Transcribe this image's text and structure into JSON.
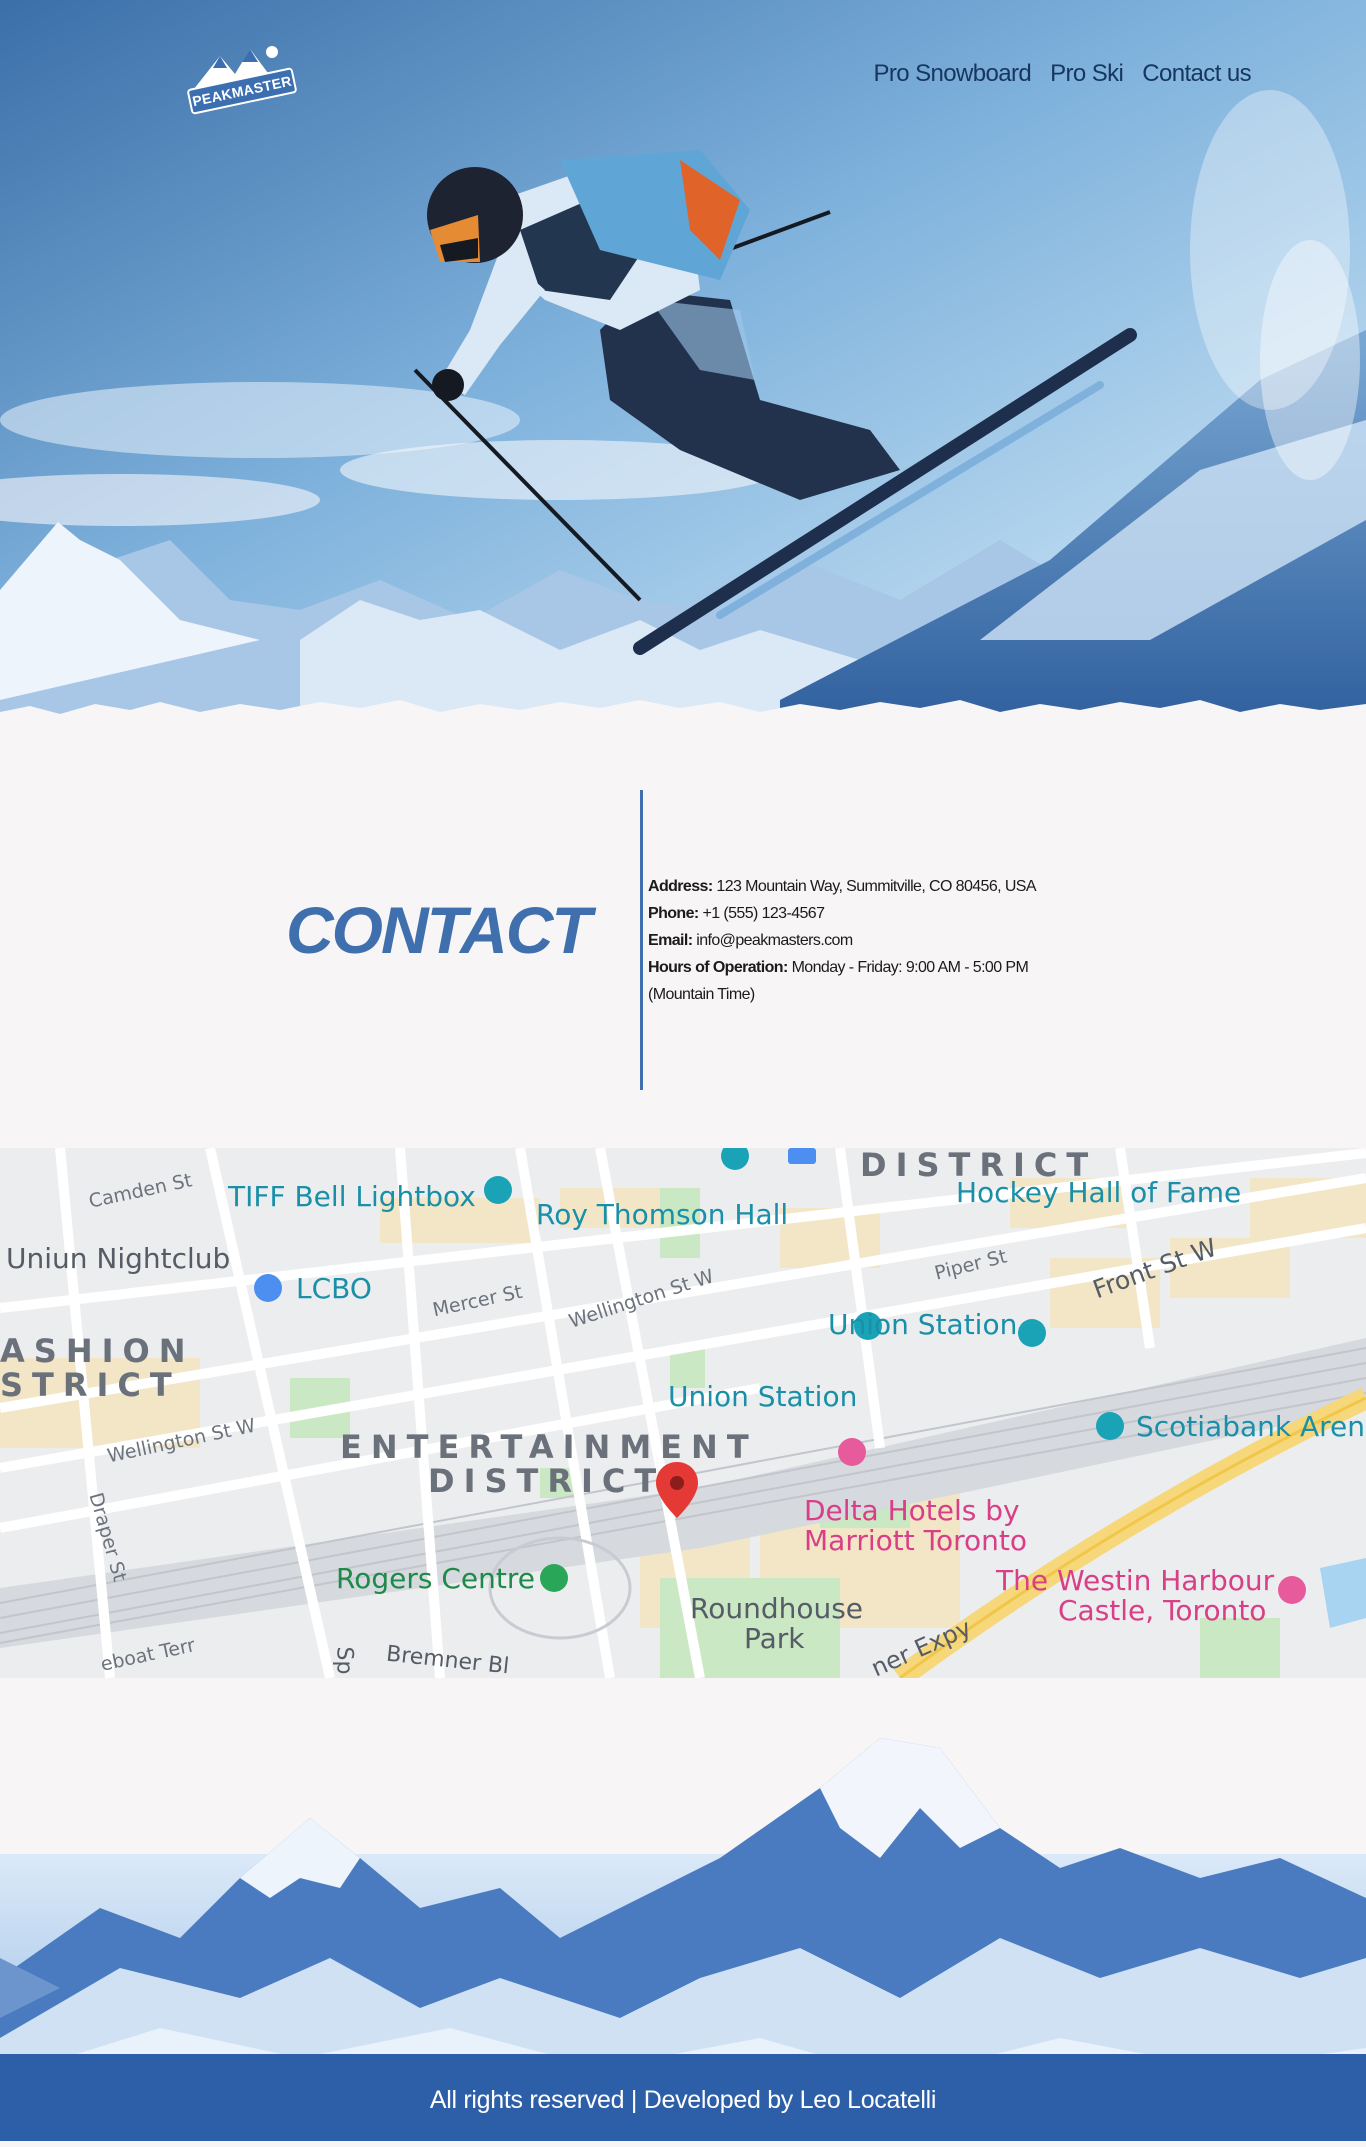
{
  "header": {
    "logo_text": "PEAKMASTER",
    "nav": [
      "Pro Snowboard",
      "Pro Ski",
      "Contact us"
    ]
  },
  "contact": {
    "title": "CONTACT",
    "address_label": "Address:",
    "address": "123 Mountain Way, Summitville, CO 80456, USA",
    "phone_label": "Phone:",
    "phone": "+1 (555) 123-4567",
    "email_label": "Email:",
    "email": "info@peakmasters.com",
    "hours_label": "Hours of Operation:",
    "hours": "Monday - Friday: 9:00 AM - 5:00 PM (Mountain Time)"
  },
  "map": {
    "labels": {
      "tiff": "TIFF Bell Lightbox",
      "roy": "Roy Thomson Hall",
      "hockey": "Hockey Hall of Fame",
      "nightclub": "Uniun Nightclub",
      "lcbo": "LCBO",
      "union1": "Union Station",
      "union2": "Union Station",
      "scotiabank": "Scotiabank Arena",
      "ent1": "ENTERTAINMENT",
      "ent2": "DISTRICT",
      "district_top": "DISTRICT",
      "fashion1": "ASHION",
      "fashion2": "STRICT",
      "delta1": "Delta Hotels by",
      "delta2": "Marriott Toronto",
      "rogers": "Rogers Centre",
      "roundhouse1": "Roundhouse",
      "roundhouse2": "Park",
      "westin1": "The Westin Harbour",
      "westin2": "Castle, Toronto",
      "camden": "Camden St",
      "mercer": "Mercer St",
      "wellington1": "Wellington St W",
      "wellington2": "Wellington St W",
      "piper": "Piper St",
      "front": "Front St W",
      "draper": "Draper St",
      "bremner": "Bremner Bl",
      "expy": "ner Expy",
      "terr": "eboat Terr",
      "sp": "Sp"
    }
  },
  "footer": {
    "text": "All rights reserved | Developed by Leo Locatelli"
  },
  "colors": {
    "accent": "#3f6fad",
    "nav_text": "#17365f",
    "footer_bg": "#2d5ea8",
    "page_bg": "#f7f5f6"
  }
}
